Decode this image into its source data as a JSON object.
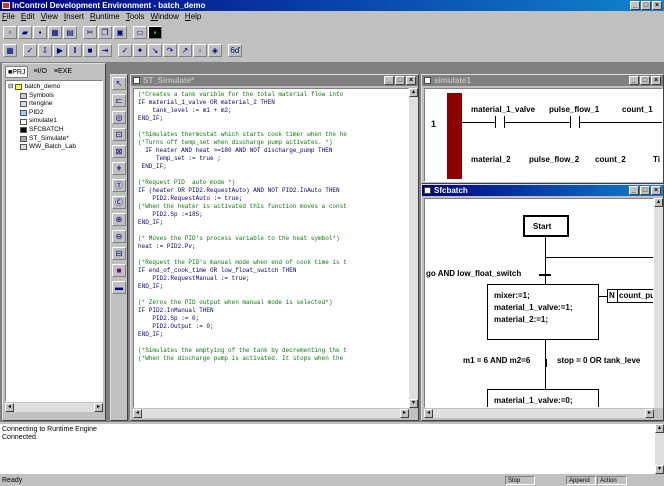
{
  "app": {
    "title": "InControl Development Environment - batch_demo"
  },
  "menu": {
    "items": [
      "File",
      "Edit",
      "View",
      "Insert",
      "Runtime",
      "Tools",
      "Window",
      "Help"
    ]
  },
  "project_tabs": [
    "PRJ",
    "I/O",
    "EXE"
  ],
  "tree": {
    "root": "batch_demo",
    "items": [
      "Symbols",
      "rtengine",
      "PID2",
      "simulate1",
      "SFCBATCH",
      "ST_Simulate*",
      "WW_Batch_Lab"
    ]
  },
  "st_window": {
    "title": "ST_Simulate*",
    "lines": [
      {
        "t": "(*Creates a tank varible for the total material flow into",
        "c": "cm"
      },
      {
        "t": "IF material_1_valve OR material_2 THEN",
        "c": "kw"
      },
      {
        "t": "    tank_level := m1 + m2;",
        "c": "kw"
      },
      {
        "t": "END_IF;",
        "c": "kw"
      },
      {
        "t": "",
        "c": "kw"
      },
      {
        "t": "(*Simulates thermostat which starts cook timer when the he",
        "c": "cm"
      },
      {
        "t": "(*Turns off temp_set when discharge pump activates. *)",
        "c": "cm"
      },
      {
        "t": "  IF heater AND heat >=180 AND NOT discharge_pump THEN",
        "c": "kw"
      },
      {
        "t": "     Temp_set := true ;",
        "c": "kw"
      },
      {
        "t": " END_IF;",
        "c": "kw"
      },
      {
        "t": "",
        "c": "kw"
      },
      {
        "t": "(*Request PID  auto mode *)",
        "c": "cm"
      },
      {
        "t": "IF (heater OR PID2.RequestAuto) AND NOT PID2.InAuto THEN",
        "c": "kw"
      },
      {
        "t": "    PID2.RequestAuto := true;",
        "c": "kw"
      },
      {
        "t": "(*When the heater is activated this function moves a const",
        "c": "cm"
      },
      {
        "t": "    PID2.Sp :=185;",
        "c": "kw"
      },
      {
        "t": "END_IF;",
        "c": "kw"
      },
      {
        "t": "",
        "c": "kw"
      },
      {
        "t": "(* Moves the PID's process variable to the heat symbol*)",
        "c": "cm"
      },
      {
        "t": "heat := PID2.Pv;",
        "c": "kw"
      },
      {
        "t": "",
        "c": "kw"
      },
      {
        "t": "(*Request the PID's manual mode when end of cook time is t",
        "c": "cm"
      },
      {
        "t": "IF end_of_cook_time OR low_float_switch THEN",
        "c": "kw"
      },
      {
        "t": "    PID2.RequestManual := true;",
        "c": "kw"
      },
      {
        "t": "END_IF;",
        "c": "kw"
      },
      {
        "t": "",
        "c": "kw"
      },
      {
        "t": "(* Zeros the PID output when manual mode is selected*)",
        "c": "cm"
      },
      {
        "t": "IF PID2.InManual THEN",
        "c": "kw"
      },
      {
        "t": "    PID2.Sp := 0;",
        "c": "kw"
      },
      {
        "t": "    PID2.Output := 0;",
        "c": "kw"
      },
      {
        "t": "END_IF;",
        "c": "kw"
      },
      {
        "t": "",
        "c": "kw"
      },
      {
        "t": "(*Simulates the emptying of the tank by decrementing the t",
        "c": "cm"
      },
      {
        "t": "(*When the discharge pump is activated. It stops when the ",
        "c": "cm"
      }
    ]
  },
  "ladder_window": {
    "title": "simulate1",
    "rung_number": "1",
    "row1": [
      "material_1_valve",
      "pulse_flow_1",
      "count_1"
    ],
    "row2": [
      "material_2",
      "pulse_flow_2",
      "count_2",
      "Ti"
    ]
  },
  "sfc_window": {
    "title": "Sfcbatch",
    "start": "Start",
    "transition1": "go AND low_float_switch",
    "step_actions": [
      "mixer:=1;",
      "material_1_valve:=1;",
      "material_2:=1;"
    ],
    "action_qualifier": "N",
    "action_name": "count_pu",
    "transition2a": "m1 = 6 AND m2=6",
    "transition2b": "stop = 0  OR tank_leve",
    "step2_action": "material_1_valve:=0;"
  },
  "output": {
    "lines": [
      "Connecting to Runtime Engine",
      "Connected."
    ]
  },
  "status": {
    "text": "Ready",
    "panels": [
      "Stop",
      "Append",
      "Action"
    ]
  }
}
